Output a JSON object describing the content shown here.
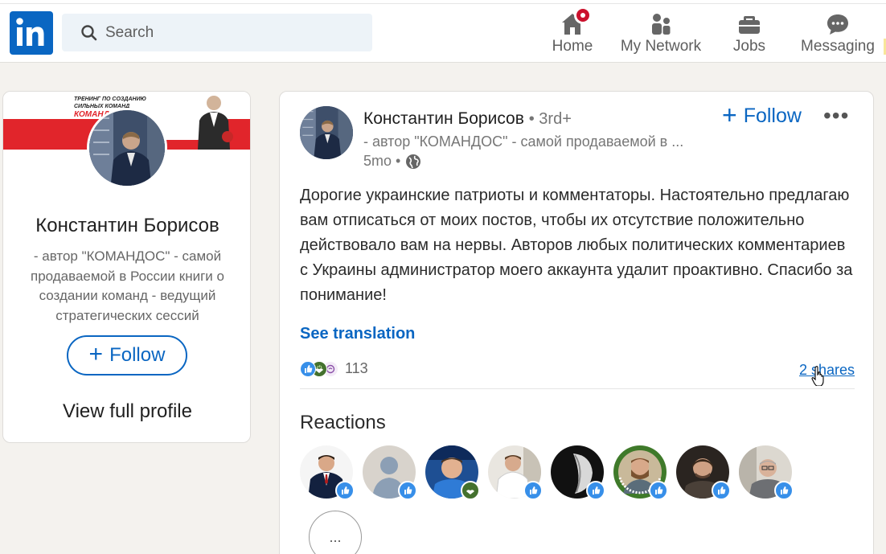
{
  "header": {
    "search_placeholder": "Search",
    "nav": [
      {
        "label": "Home",
        "icon": "home-icon"
      },
      {
        "label": "My Network",
        "icon": "network-icon"
      },
      {
        "label": "Jobs",
        "icon": "briefcase-icon"
      },
      {
        "label": "Messaging",
        "icon": "messaging-icon"
      }
    ],
    "colors": {
      "brand": "#0a66c2",
      "badge": "#cb112d"
    }
  },
  "profile_card": {
    "banner_text": "ТРЕНИНГ ПО СОЗДАНИЮ СИЛЬНЫХ КОМАНД",
    "banner_brand": "КОМАНДОС",
    "name": "Константин Борисов",
    "description": "- автор \"КОМАНДОС\" - самой продаваемой в России книги о создании команд - ведущий стратегических сессий",
    "follow_label": "Follow",
    "view_profile_label": "View full profile"
  },
  "post": {
    "author": "Константин Борисов",
    "degree": "• 3rd+",
    "headline": "- автор \"КОМАНДОС\" - самой продаваемой в ...",
    "time": "5mo •",
    "follow_label": "Follow",
    "more_label": "•••",
    "text": "Дорогие украинские патриоты и комментаторы. Настоятельно предлагаю вам отписаться от моих постов, чтобы их отсутствие положительно действовало вам на нервы. Авторов любых политических комментариев с Украины администратор моего аккаунта удалит проактивно. Спасибо за понимание!",
    "see_translation": "See translation",
    "reaction_count": "113",
    "shares": "2 shares",
    "reactions_title": "Reactions",
    "more_reactors": "..."
  }
}
